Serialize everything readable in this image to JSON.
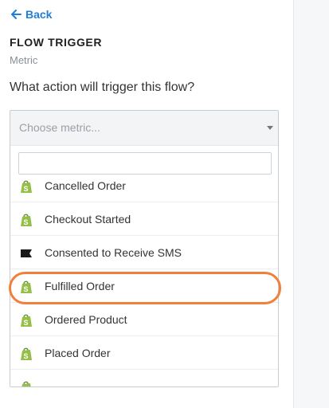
{
  "nav": {
    "back_label": "Back"
  },
  "section": {
    "title": "FLOW TRIGGER",
    "subtitle": "Metric"
  },
  "question": "What action will trigger this flow?",
  "select": {
    "placeholder": "Choose metric...",
    "search_value": ""
  },
  "options": [
    {
      "label": "Cancelled Order",
      "icon": "shopify-icon"
    },
    {
      "label": "Checkout Started",
      "icon": "shopify-icon"
    },
    {
      "label": "Consented to Receive SMS",
      "icon": "flag-icon"
    },
    {
      "label": "Fulfilled Order",
      "icon": "shopify-icon",
      "highlighted": true
    },
    {
      "label": "Ordered Product",
      "icon": "shopify-icon"
    },
    {
      "label": "Placed Order",
      "icon": "shopify-icon"
    }
  ],
  "colors": {
    "accent": "#1f7fd6",
    "highlight_ring": "#f0803c",
    "shopify_green": "#95bf47"
  }
}
